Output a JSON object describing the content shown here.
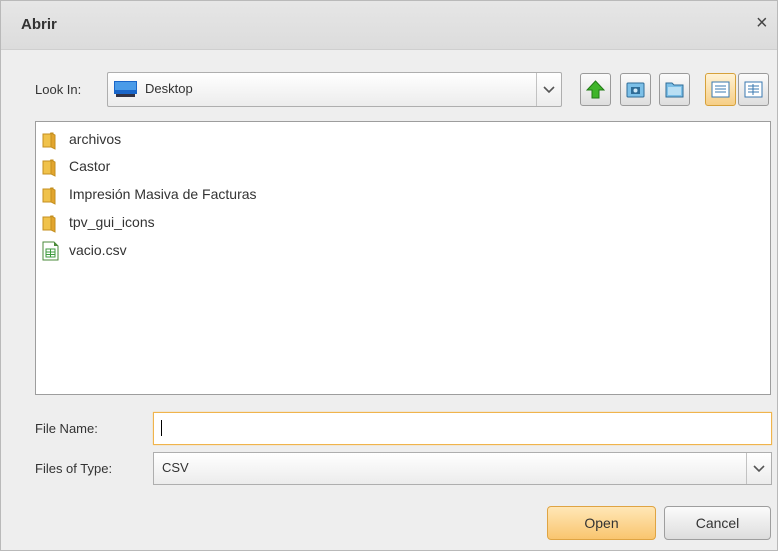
{
  "window": {
    "title": "Abrir",
    "close_glyph": "×"
  },
  "look_in": {
    "label": "Look In:",
    "value": "Desktop",
    "icon": "desktop-icon"
  },
  "toolbar": {
    "buttons": [
      "up-one-level-icon",
      "home-icon",
      "new-folder-icon",
      "list-view-icon",
      "details-view-icon"
    ],
    "selected": "list-view-icon"
  },
  "files": [
    {
      "name": "archivos",
      "type": "folder"
    },
    {
      "name": "Castor",
      "type": "folder"
    },
    {
      "name": "Impresión Masiva de Facturas",
      "type": "folder"
    },
    {
      "name": "tpv_gui_icons",
      "type": "folder"
    },
    {
      "name": "vacio.csv",
      "type": "spreadsheet-file"
    }
  ],
  "file_name": {
    "label": "File Name:",
    "value": ""
  },
  "files_of_type": {
    "label": "Files of Type:",
    "value": "CSV"
  },
  "buttons": {
    "open": "Open",
    "cancel": "Cancel"
  },
  "colors": {
    "accent": "#f9c56f",
    "folder": "#e8b23d",
    "focus_border": "#f0b44c"
  }
}
